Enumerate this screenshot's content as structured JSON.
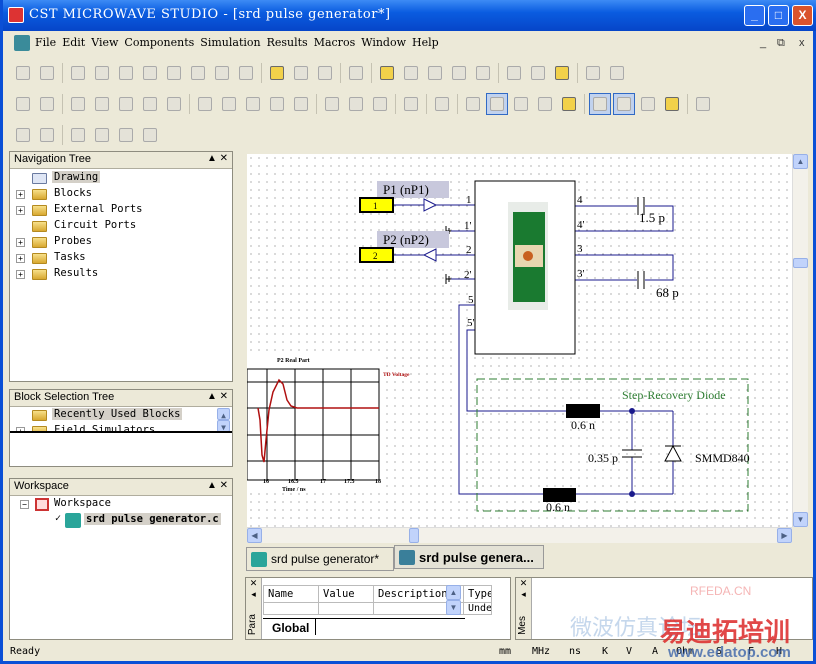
{
  "window": {
    "title": "CST MICROWAVE STUDIO - [srd pulse generator*]",
    "minimize": "_",
    "maximize": "□",
    "close": "X"
  },
  "menu": {
    "items": [
      "File",
      "Edit",
      "View",
      "Components",
      "Simulation",
      "Results",
      "Macros",
      "Window",
      "Help"
    ],
    "mdi_min": "_",
    "mdi_restore": "⧉",
    "mdi_close": "x"
  },
  "toolbar_rows": [
    [
      "new-file-icon",
      "open-folder-icon",
      "|",
      "save-icon",
      "save-all-icon",
      "print-icon",
      "undo-icon",
      "redo-icon",
      "copy-icon",
      "paste-icon",
      "cut-icon",
      "|",
      "ruler-icon",
      "add-task-icon",
      "run-icon",
      "|",
      "export-icon",
      "|",
      "port-number-icon",
      "probe-icon",
      "ground-icon",
      "wire-icon",
      "cut-wire-icon",
      "|",
      "block-icon",
      "block2-icon",
      "import-icon",
      "|",
      "cascade-icon",
      "tile-icon"
    ],
    [
      "zoom-fit-icon",
      "pan-icon",
      "|",
      "chart1-icon",
      "chart2-icon",
      "chart3-icon",
      "chart4-icon",
      "chart5-icon",
      "|",
      "layout1-icon",
      "layout2-icon",
      "layout3-icon",
      "layout4-icon",
      "layout5-icon",
      "|",
      "smith1-icon",
      "smith2-icon",
      "smith3-icon",
      "|",
      "graph-icon",
      "|",
      "report-icon",
      "|",
      "select-arrow-icon",
      "zoom-icon",
      "rotate-icon",
      "mirror-icon",
      "move-icon",
      "|",
      "grid-icon",
      "grid-snap-icon",
      "frame-icon",
      "measure-icon",
      "|",
      "settings-icon"
    ],
    [
      "align1-icon",
      "align2-icon",
      "|",
      "group1-icon",
      "group2-icon",
      "group3-icon",
      "group4-icon"
    ]
  ],
  "navigation_tree": {
    "title": "Navigation Tree",
    "items": [
      {
        "label": "Drawing",
        "expandable": false,
        "selected": true
      },
      {
        "label": "Blocks",
        "expandable": true
      },
      {
        "label": "External Ports",
        "expandable": true
      },
      {
        "label": "Circuit Ports",
        "expandable": false
      },
      {
        "label": "Probes",
        "expandable": true
      },
      {
        "label": "Tasks",
        "expandable": true
      },
      {
        "label": "Results",
        "expandable": true
      }
    ]
  },
  "block_selection_tree": {
    "title": "Block Selection Tree",
    "items": [
      "Recently Used Blocks",
      "Field Simulators"
    ]
  },
  "workspace": {
    "title": "Workspace",
    "root": "Workspace",
    "project": "srd pulse generator.c"
  },
  "schematic": {
    "ports": [
      {
        "number": "1",
        "label": "P1 (nP1)"
      },
      {
        "number": "2",
        "label": "P2 (nP2)"
      }
    ],
    "pins": [
      "1",
      "1'",
      "2",
      "2'",
      "5",
      "5'",
      "4",
      "4'",
      "3",
      "3'"
    ],
    "capacitors": [
      "1.5 p",
      "68 p",
      "0.35 p"
    ],
    "inductors": [
      "0.6 n",
      "0.6 n"
    ],
    "group_label": "Step-Recovery Diode",
    "diode": "SMMD840",
    "colors": {
      "wire": "#1a1a8c",
      "group": "#2e7d32",
      "port": "#ffff00",
      "plot": "#b01010"
    }
  },
  "plot": {
    "title": "P2 Real Part",
    "legend": "TD Voltage",
    "xlabel": "Time / ns",
    "xticks": [
      "16",
      "16.5",
      "17",
      "17.5",
      "18"
    ]
  },
  "tabs": [
    {
      "label": "srd pulse generator*",
      "active": false
    },
    {
      "label": "srd pulse genera...",
      "active": true
    }
  ],
  "parameters": {
    "tab_label": "Para",
    "columns": [
      "Name",
      "Value",
      "Description",
      "Type"
    ],
    "row": [
      "",
      "",
      "",
      "Undef"
    ],
    "sheet_tab": "Global"
  },
  "messages": {
    "tab_label": "Mes"
  },
  "status": {
    "text": "Ready",
    "units": [
      "mm",
      "MHz",
      "ns",
      "K",
      "V",
      "A",
      "Ohm",
      "S",
      "F",
      "H"
    ]
  },
  "watermark": {
    "a": "RFEDA.CN",
    "b": "易迪拓培训",
    "c": "www.edatop.com",
    "d": "微波仿真论坛"
  }
}
